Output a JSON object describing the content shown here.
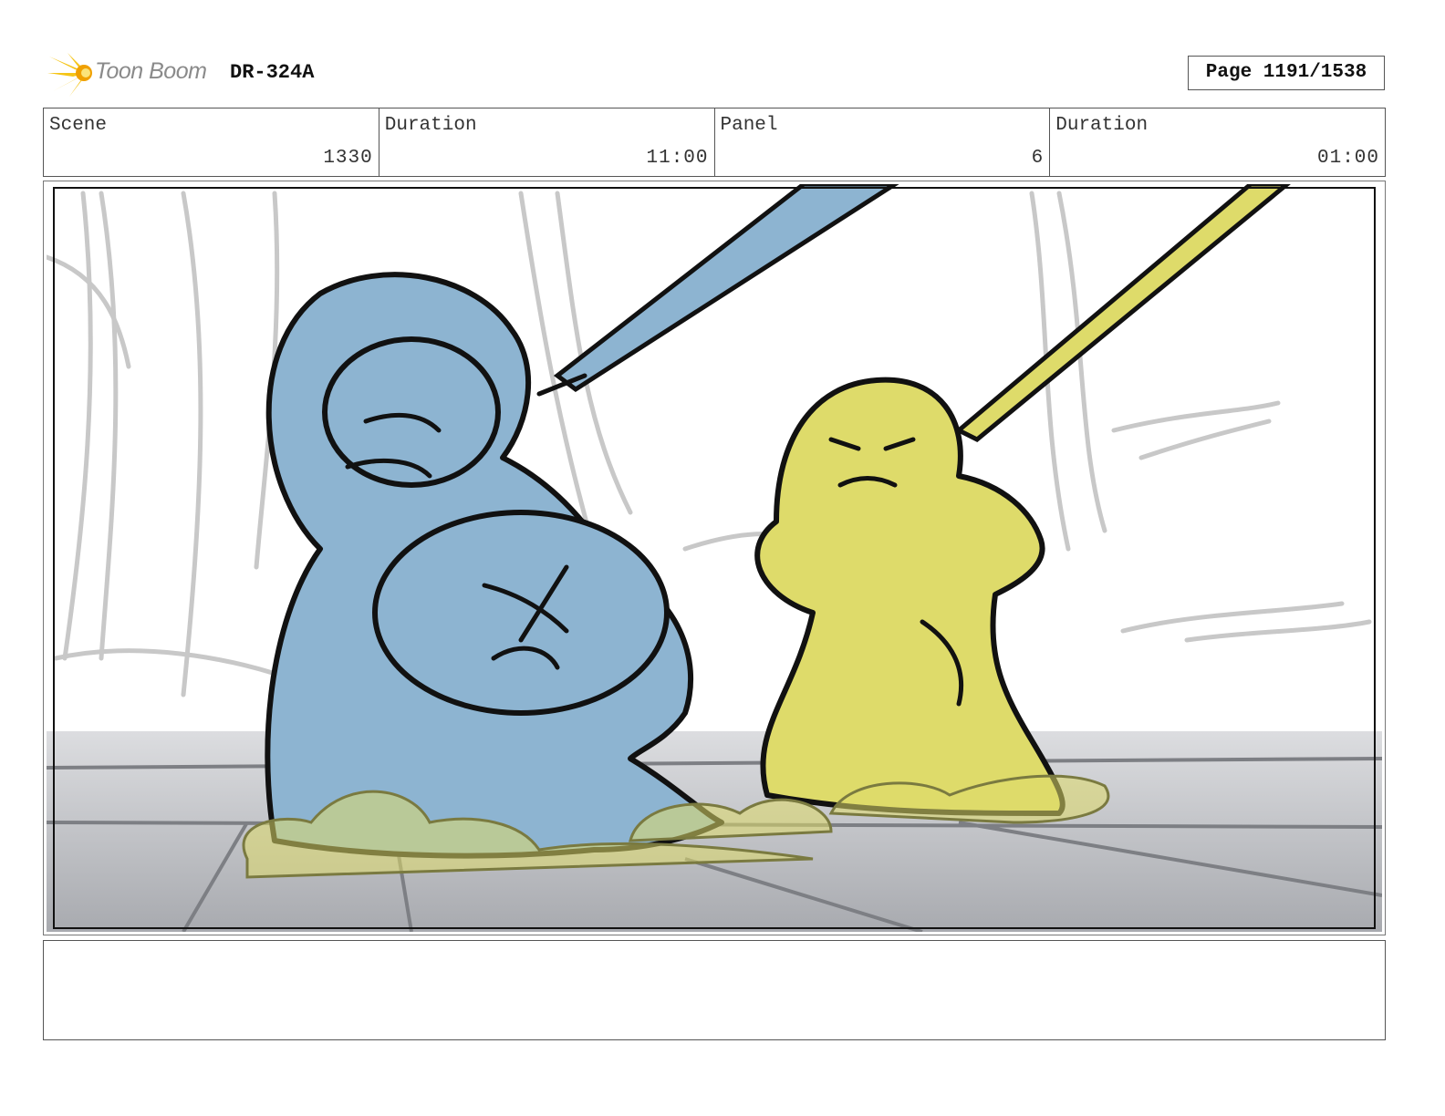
{
  "header": {
    "logo_text": "Toon Boom",
    "production_code": "DR-324A",
    "page_label": "Page 1191/1538"
  },
  "info": {
    "scene_label": "Scene",
    "scene_value": "1330",
    "scene_duration_label": "Duration",
    "scene_duration_value": "11:00",
    "panel_label": "Panel",
    "panel_value": "6",
    "panel_duration_label": "Duration",
    "panel_duration_value": "01:00"
  },
  "colors": {
    "blue_character": "#8db4d1",
    "yellow_character": "#dedb6a",
    "floor": "#b4b6bb",
    "logo_accent": "#f5c518"
  }
}
